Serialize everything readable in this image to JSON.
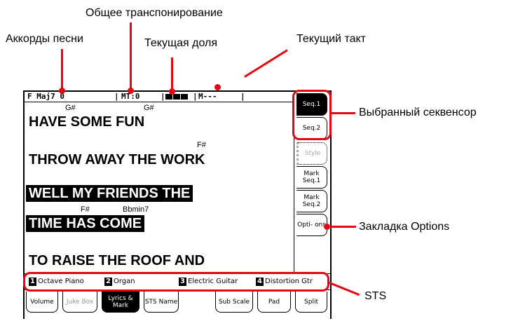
{
  "callouts": {
    "global_transpose": "Общее транспонирование",
    "song_chords": "Аккорды песни",
    "current_beat": "Текущая доля",
    "current_measure": "Текущий такт",
    "selected_sequencer": "Выбранный секвенсор",
    "options_tab": "Закладка Options",
    "sts": "STS"
  },
  "status": {
    "chord": "F Maj7 0",
    "transpose": "MT:0",
    "measure": "M---"
  },
  "lyrics": [
    {
      "text": "HAVE SOME FUN",
      "highlighted": false,
      "chords": [
        "G#",
        "G#"
      ]
    },
    {
      "text": "THROW AWAY THE WORK",
      "highlighted": false,
      "chords": [
        "F#"
      ]
    },
    {
      "text": "WELL MY FRIENDS THE",
      "highlighted": true,
      "chords": []
    },
    {
      "text": "TIME HAS COME",
      "highlighted": true,
      "chords": [
        "F#",
        "Bbmin7"
      ]
    },
    {
      "text": "TO RAISE THE ROOF AND",
      "highlighted": false,
      "chords": []
    }
  ],
  "side_tabs": [
    {
      "label": "Seq.1",
      "state": "selected"
    },
    {
      "label": "Seq.2",
      "state": "normal"
    },
    {
      "label": "Style",
      "state": "disabled"
    },
    {
      "label": "Mark Seq.1",
      "state": "normal"
    },
    {
      "label": "Mark Seq.2",
      "state": "normal"
    },
    {
      "label": "Opti- ons",
      "state": "normal"
    }
  ],
  "sts": [
    {
      "num": "1",
      "name": "Octave Piano"
    },
    {
      "num": "2",
      "name": "Organ"
    },
    {
      "num": "3",
      "name": "Electric Guitar"
    },
    {
      "num": "4",
      "name": "Distortion Gtr"
    }
  ],
  "bottom_tabs": [
    {
      "label": "Volume",
      "state": "normal"
    },
    {
      "label": "Juke Box",
      "state": "disabled"
    },
    {
      "label": "Lyrics & Mark",
      "state": "selected"
    },
    {
      "label": "STS Name",
      "state": "normal"
    },
    {
      "label": "Sub Scale",
      "state": "normal"
    },
    {
      "label": "Pad",
      "state": "normal"
    },
    {
      "label": "Split",
      "state": "normal"
    }
  ]
}
